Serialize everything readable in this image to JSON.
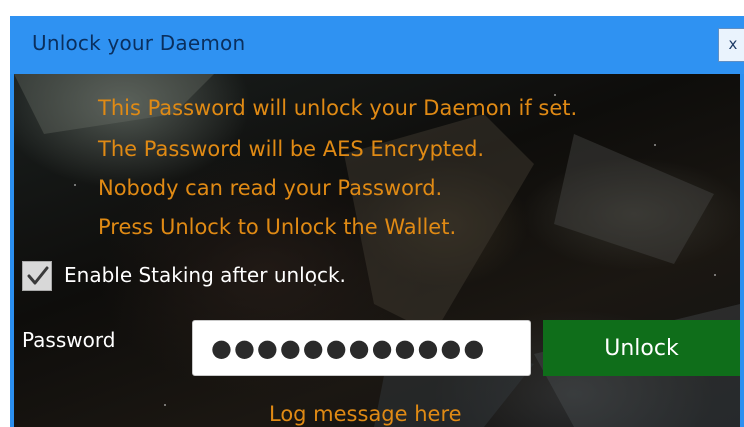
{
  "window": {
    "title": "Unlock your Daemon",
    "close_label": "x"
  },
  "info": {
    "lines": [
      "This Password will unlock your Daemon if set.",
      "The Password will be AES Encrypted.",
      "Nobody can read your Password.",
      "Press Unlock to Unlock the Wallet."
    ]
  },
  "staking": {
    "checked": true,
    "label": "Enable Staking after unlock."
  },
  "password": {
    "label": "Password",
    "value": "●●●●●●●●●●●●"
  },
  "unlock_button": {
    "label": "Unlock"
  },
  "log": {
    "message": "Log message here"
  },
  "colors": {
    "titlebar": "#2f92f2",
    "info_text": "#e08a14",
    "unlock_button": "#0f6e1a"
  },
  "icons": {
    "checkbox": "check-icon"
  }
}
